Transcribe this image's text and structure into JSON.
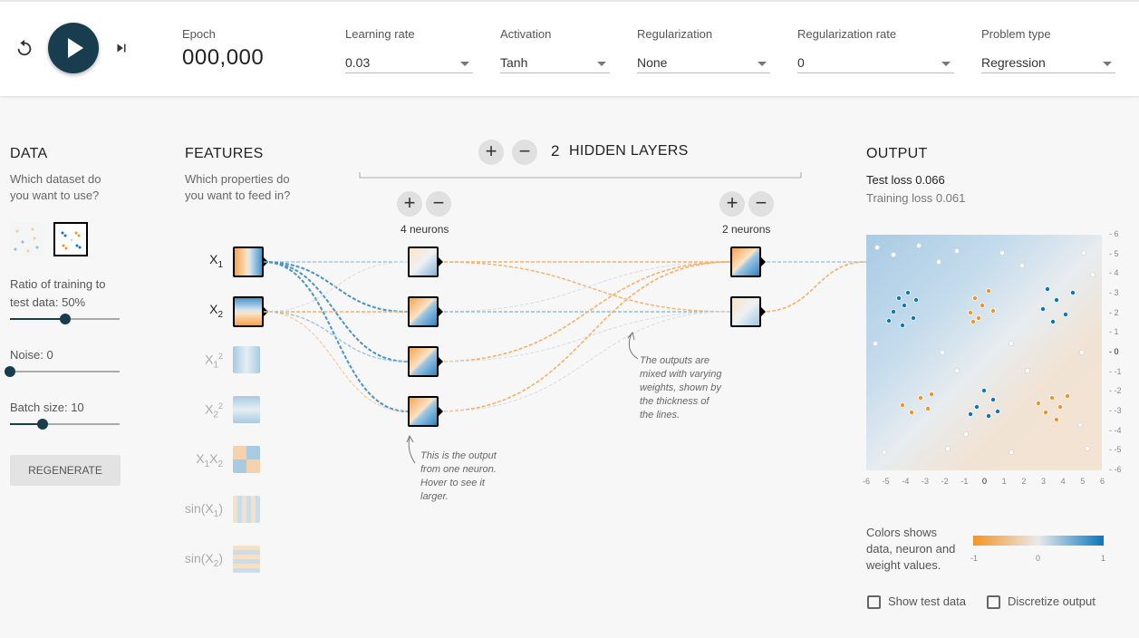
{
  "controls": {
    "epoch_label": "Epoch",
    "epoch_value": "000,000",
    "learning_rate": {
      "label": "Learning rate",
      "value": "0.03"
    },
    "activation": {
      "label": "Activation",
      "value": "Tanh"
    },
    "regularization": {
      "label": "Regularization",
      "value": "None"
    },
    "regularization_rate": {
      "label": "Regularization rate",
      "value": "0"
    },
    "problem_type": {
      "label": "Problem type",
      "value": "Regression"
    }
  },
  "data_panel": {
    "title": "DATA",
    "subtitle_line1": "Which dataset do",
    "subtitle_line2": "you want to use?",
    "ratio_label_line1": "Ratio of training to",
    "ratio_label_line2": "test data:  50%",
    "ratio_value": 0.5,
    "noise_label": "Noise:  0",
    "noise_value": 0,
    "batch_label": "Batch size:  10",
    "batch_value": 0.3,
    "regenerate": "REGENERATE"
  },
  "features_panel": {
    "title": "FEATURES",
    "subtitle_line1": "Which properties do",
    "subtitle_line2": "you want to feed in?",
    "features": [
      {
        "name": "X1",
        "active": true
      },
      {
        "name": "X2",
        "active": true
      },
      {
        "name": "X1^2",
        "active": false
      },
      {
        "name": "X2^2",
        "active": false
      },
      {
        "name": "X1X2",
        "active": false
      },
      {
        "name": "sin(X1)",
        "active": false
      },
      {
        "name": "sin(X2)",
        "active": false
      }
    ]
  },
  "network": {
    "hidden_layers_count": "2",
    "hidden_layers_label": "HIDDEN LAYERS",
    "layer1_neurons": "4 neurons",
    "layer2_neurons": "2 neurons",
    "plus": "+",
    "minus": "−",
    "note_neuron": [
      "This is the output",
      "from one neuron.",
      "Hover to see it",
      "larger."
    ],
    "note_weights": [
      "The outputs are",
      "mixed with varying",
      "weights, shown by",
      "the thickness of",
      "the lines."
    ]
  },
  "output_panel": {
    "title": "OUTPUT",
    "test_loss_label": "Test loss",
    "test_loss_value": "0.066",
    "training_loss_label": "Training loss",
    "training_loss_value": "0.061",
    "x_ticks": [
      "-6",
      "-5",
      "-4",
      "-3",
      "-2",
      "-1",
      "0",
      "1",
      "2",
      "3",
      "4",
      "5",
      "6"
    ],
    "y_ticks": [
      "6",
      "5",
      "4",
      "3",
      "2",
      "1",
      "0",
      "-1",
      "-2",
      "-3",
      "-4",
      "-5",
      "-6"
    ],
    "legend_text_line1": "Colors shows",
    "legend_text_line2": "data, neuron and",
    "legend_text_line3": "weight values.",
    "legend_min": "-1",
    "legend_mid": "0",
    "legend_max": "1",
    "show_test_data": "Show test data",
    "discretize_output": "Discretize output"
  },
  "colors": {
    "dark": "#183d4e",
    "orange": "#f59322",
    "blue": "#0877bd"
  }
}
